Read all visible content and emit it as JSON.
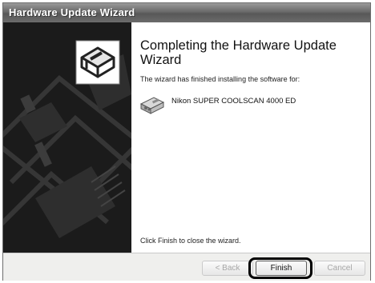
{
  "window": {
    "title": "Hardware Update Wizard"
  },
  "content": {
    "heading": "Completing the Hardware Update Wizard",
    "description": "The wizard has finished installing the software for:",
    "device_name": "Nikon SUPER COOLSCAN 4000 ED",
    "device_icon": "scanner-icon",
    "footer": "Click Finish to close the wizard."
  },
  "buttons": {
    "back": "< Back",
    "finish": "Finish",
    "cancel": "Cancel"
  }
}
